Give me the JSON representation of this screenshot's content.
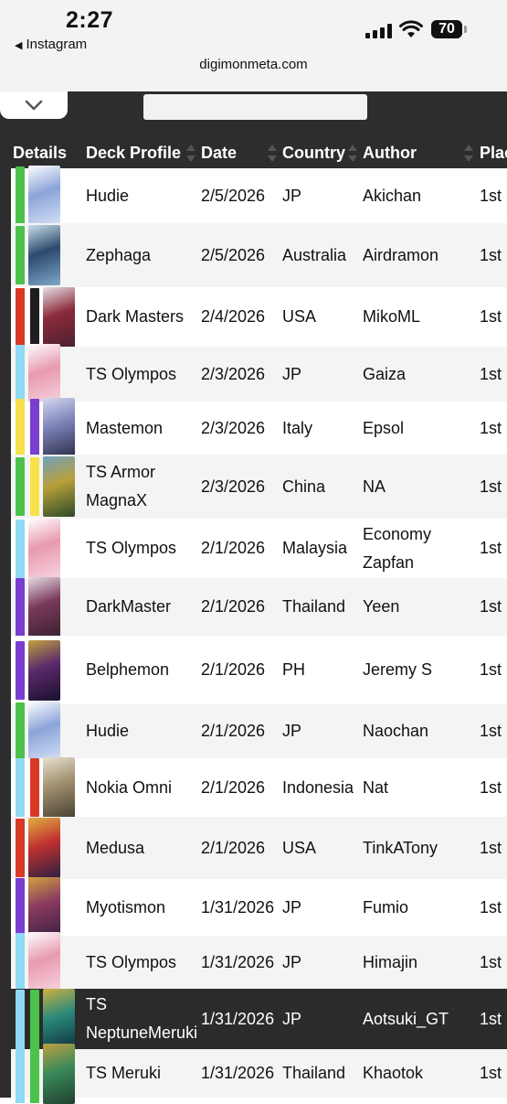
{
  "status_bar": {
    "time": "2:27",
    "back_label": "Instagram",
    "battery": "70"
  },
  "browser": {
    "url": "digimonmeta.com"
  },
  "table": {
    "headers": {
      "details": "Details",
      "deck_profile": "Deck Profile",
      "date": "Date",
      "country": "Country",
      "author": "Author",
      "placement": "Plac"
    },
    "rows": [
      {
        "deck": "Hudie",
        "date": "2/5/2026",
        "country": "JP",
        "author": "Akichan",
        "place": "1st",
        "colors": [
          "#4cc24a"
        ]
      },
      {
        "deck": "Zephaga",
        "date": "2/5/2026",
        "country": "Australia",
        "author": "Airdramon",
        "place": "1st",
        "colors": [
          "#4cc24a"
        ]
      },
      {
        "deck": "Dark Masters",
        "date": "2/4/2026",
        "country": "USA",
        "author": "MikoML",
        "place": "1st",
        "colors": [
          "#d83a26",
          "#1e1e1e"
        ]
      },
      {
        "deck": "TS Olympos",
        "date": "2/3/2026",
        "country": "JP",
        "author": "Gaiza",
        "place": "1st",
        "colors": [
          "#8fdaf5"
        ]
      },
      {
        "deck": "Mastemon",
        "date": "2/3/2026",
        "country": "Italy",
        "author": "Epsol",
        "place": "1st",
        "colors": [
          "#f6e14a",
          "#7a3ed1"
        ]
      },
      {
        "deck": "TS Armor MagnaX",
        "date": "2/3/2026",
        "country": "China",
        "author": "NA",
        "place": "1st",
        "colors": [
          "#4cc24a",
          "#f6e14a"
        ]
      },
      {
        "deck": "TS Olympos",
        "date": "2/1/2026",
        "country": "Malaysia",
        "author": "Economy Zapfan",
        "place": "1st",
        "colors": [
          "#8fdaf5"
        ]
      },
      {
        "deck": "DarkMaster",
        "date": "2/1/2026",
        "country": "Thailand",
        "author": "Yeen",
        "place": "1st",
        "colors": [
          "#7a3ed1"
        ]
      },
      {
        "deck": "Belphemon",
        "date": "2/1/2026",
        "country": "PH",
        "author": "Jeremy S",
        "place": "1st",
        "colors": [
          "#7a3ed1"
        ]
      },
      {
        "deck": "Hudie",
        "date": "2/1/2026",
        "country": "JP",
        "author": "Naochan",
        "place": "1st",
        "colors": [
          "#4cc24a"
        ]
      },
      {
        "deck": "Nokia Omni",
        "date": "2/1/2026",
        "country": "Indonesia",
        "author": "Nat",
        "place": "1st",
        "colors": [
          "#8fdaf5",
          "#d83a26"
        ]
      },
      {
        "deck": "Medusa",
        "date": "2/1/2026",
        "country": "USA",
        "author": "TinkATony",
        "place": "1st",
        "colors": [
          "#d83a26"
        ]
      },
      {
        "deck": "Myotismon",
        "date": "1/31/2026",
        "country": "JP",
        "author": "Fumio",
        "place": "1st",
        "colors": [
          "#7a3ed1"
        ]
      },
      {
        "deck": "TS Olympos",
        "date": "1/31/2026",
        "country": "JP",
        "author": "Himajin",
        "place": "1st",
        "colors": [
          "#8fdaf5"
        ]
      },
      {
        "deck": "TS NeptuneMeruki",
        "date": "1/31/2026",
        "country": "JP",
        "author": "Aotsuki_GT",
        "place": "1st",
        "colors": [
          "#8fdaf5",
          "#4cc24a"
        ]
      },
      {
        "deck": "TS Meruki",
        "date": "1/31/2026",
        "country": "Thailand",
        "author": "Khaotok",
        "place": "1st",
        "colors": [
          "#8fdaf5",
          "#4cc24a"
        ]
      }
    ]
  }
}
